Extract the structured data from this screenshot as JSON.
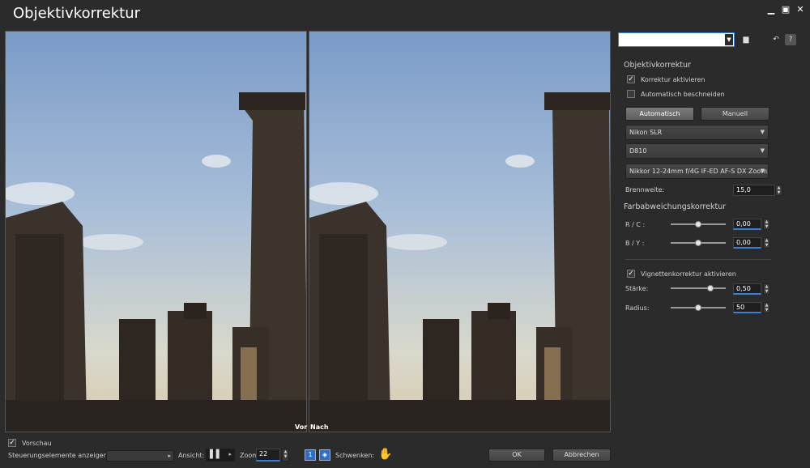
{
  "window": {
    "title": "Objektivkorrektur",
    "controls": [
      "minimize-icon",
      "maximize-icon",
      "close-icon"
    ]
  },
  "preview": {
    "before_label": "Vor",
    "after_label": "Nach"
  },
  "panel": {
    "preset_value": "",
    "section_lens": "Objektivkorrektur",
    "enable_correction": "Korrektur aktivieren",
    "auto_straighten": "Automatisch beschneiden",
    "btn_auto": "Automatisch",
    "btn_manual": "Manuell",
    "camera_brand": "Nikon SLR",
    "camera_model": "D810",
    "lens": "Nikkor 12-24mm f/4G IF-ED AF-S DX Zoom",
    "focal_label": "Brennweite:",
    "focal_value": "15,0",
    "section_ca": "Farbabweichungskorrektur",
    "rc_label": "R / C :",
    "rc_value": "0,00",
    "by_label": "B / Y :",
    "by_value": "0,00",
    "vignette_enable": "Vignettenkorrektur aktivieren",
    "strength_label": "Stärke:",
    "strength_value": "0,50",
    "radius_label": "Radius:",
    "radius_value": "50"
  },
  "sliders": {
    "rc": 0.5,
    "by": 0.5,
    "strength": 0.75,
    "radius": 0.5
  },
  "bottom": {
    "preview_label": "Vorschau",
    "controls_label": "Steuerungselemente anzeigen:",
    "view_label": "Ansicht:",
    "zoom_label": "Zoom:",
    "zoom_value": "22",
    "pan_label": "Schwenken:",
    "ok_label": "OK",
    "cancel_label": "Abbrechen"
  }
}
